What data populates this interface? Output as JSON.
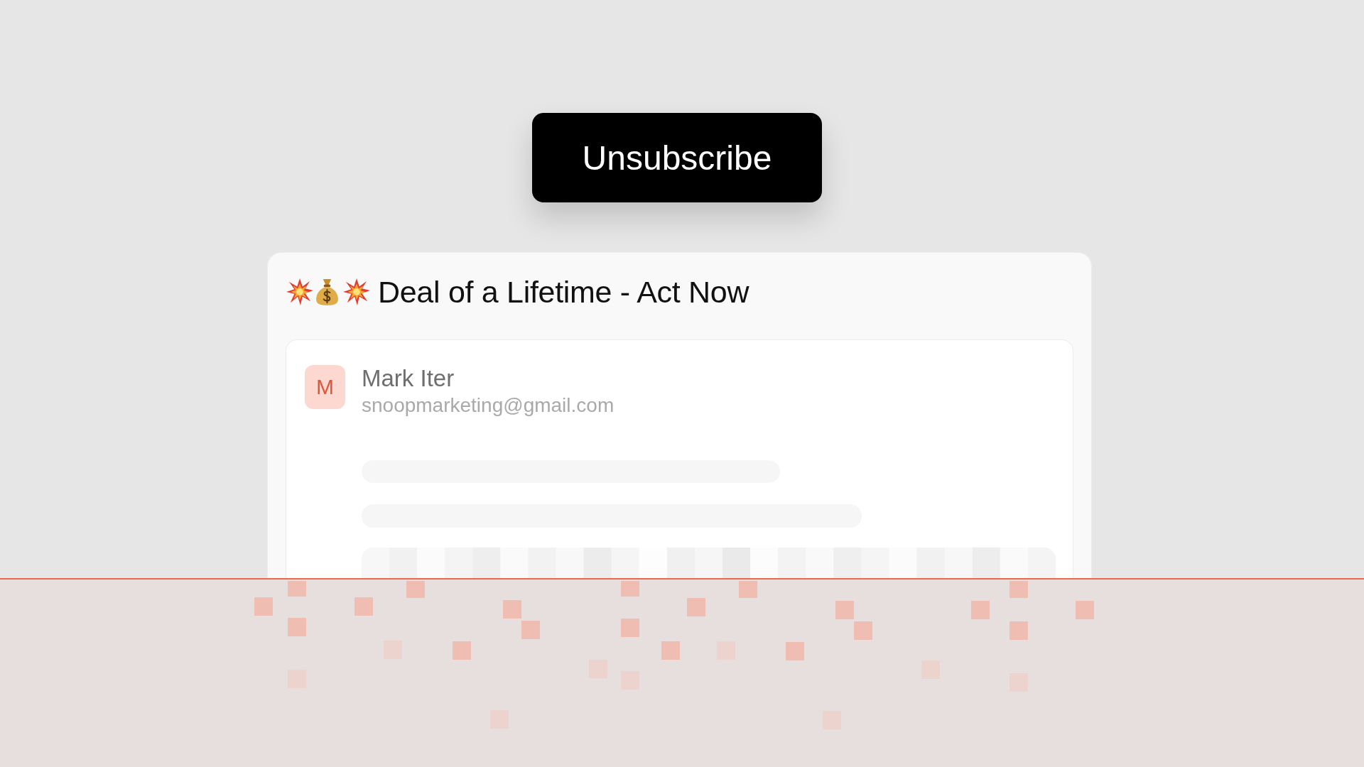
{
  "action_button": {
    "label": "Unsubscribe"
  },
  "email": {
    "subject": "Deal of a Lifetime - Act Now",
    "sender": {
      "initial": "M",
      "name": "Mark Iter",
      "address": "snoopmarketing@gmail.com"
    }
  }
}
